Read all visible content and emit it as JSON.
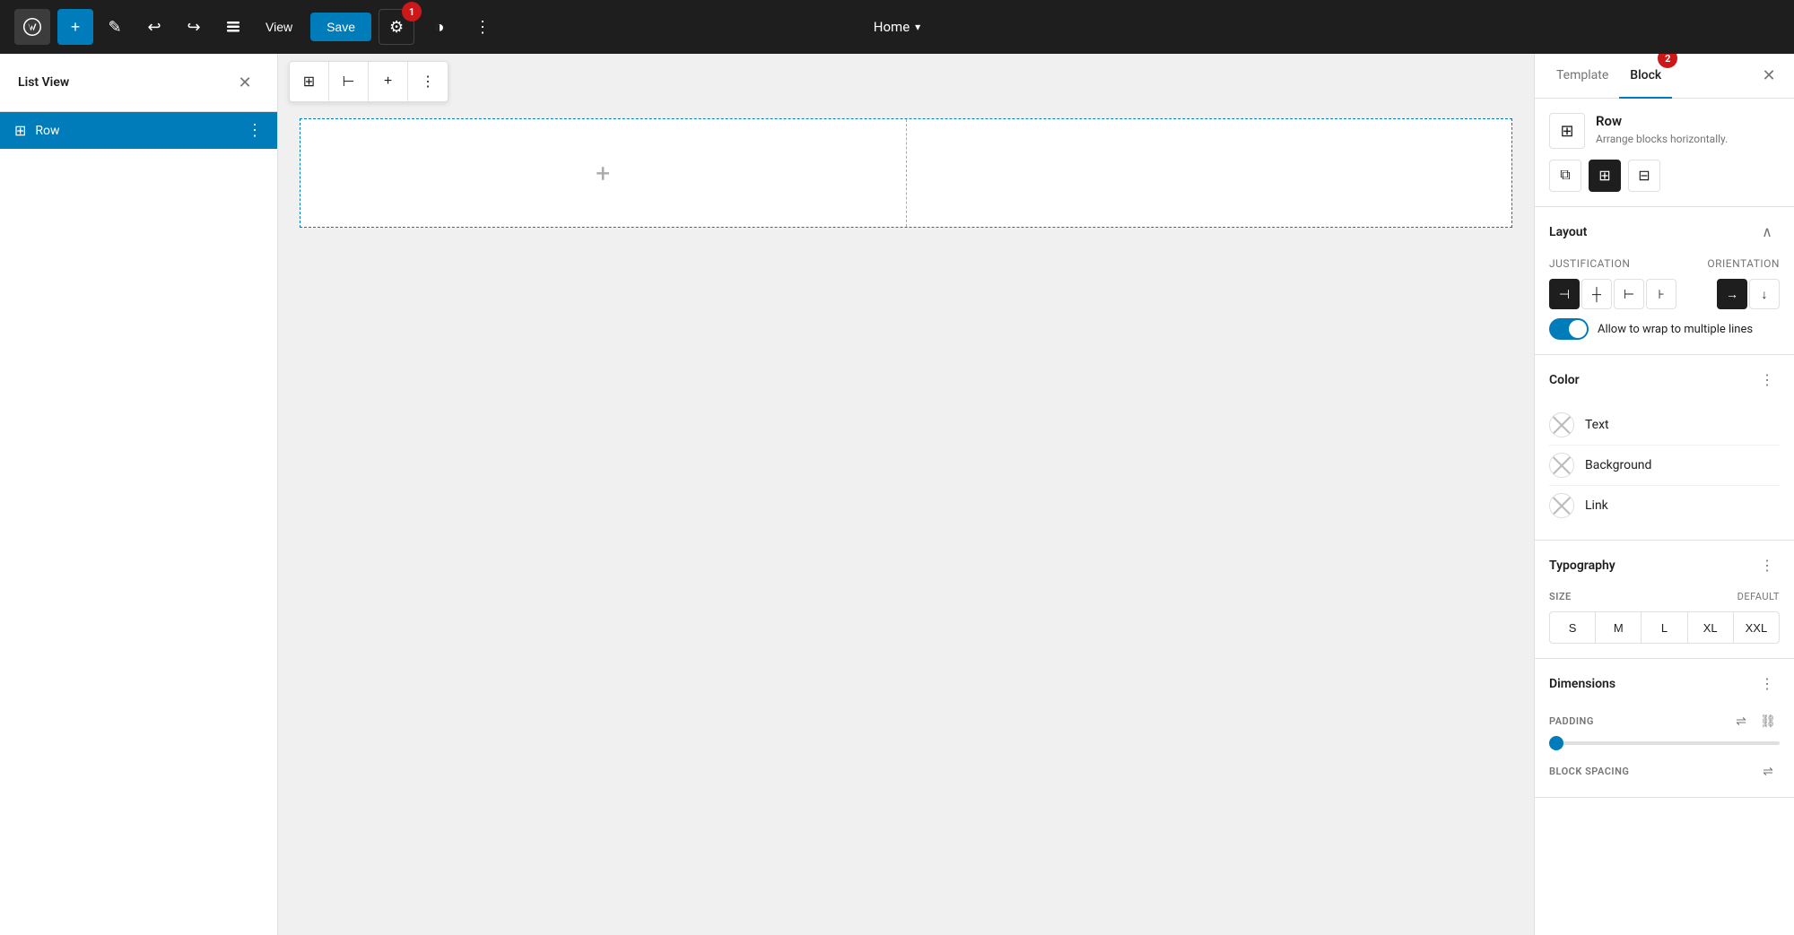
{
  "toolbar": {
    "page_title": "Home",
    "view_label": "View",
    "save_label": "Save",
    "badge1": "1",
    "badge2": "2"
  },
  "sidebar": {
    "title": "List View",
    "items": [
      {
        "label": "Row",
        "icon": "⊞",
        "active": true
      }
    ]
  },
  "block_toolbar": {
    "buttons": [
      "⊞",
      "⊢",
      "+",
      "⋮"
    ]
  },
  "right_panel": {
    "tabs": [
      {
        "label": "Template",
        "active": false
      },
      {
        "label": "Block",
        "active": true
      }
    ],
    "block_info": {
      "name": "Row",
      "description": "Arrange blocks horizontally."
    },
    "layout": {
      "title": "Layout",
      "justification_label": "Justification",
      "orientation_label": "Orientation",
      "justify_buttons": [
        "⊣",
        "+",
        "⊢",
        "⊦"
      ],
      "orient_buttons": [
        "→",
        "↓"
      ],
      "wrap_label": "Allow to wrap to multiple lines"
    },
    "color": {
      "title": "Color",
      "items": [
        {
          "label": "Text"
        },
        {
          "label": "Background"
        },
        {
          "label": "Link"
        }
      ]
    },
    "typography": {
      "title": "Typography",
      "size_label": "SIZE",
      "size_default": "DEFAULT",
      "sizes": [
        "S",
        "M",
        "L",
        "XL",
        "XXL"
      ]
    },
    "dimensions": {
      "title": "Dimensions",
      "padding_label": "PADDING",
      "block_spacing_label": "BLOCK SPACING"
    }
  }
}
